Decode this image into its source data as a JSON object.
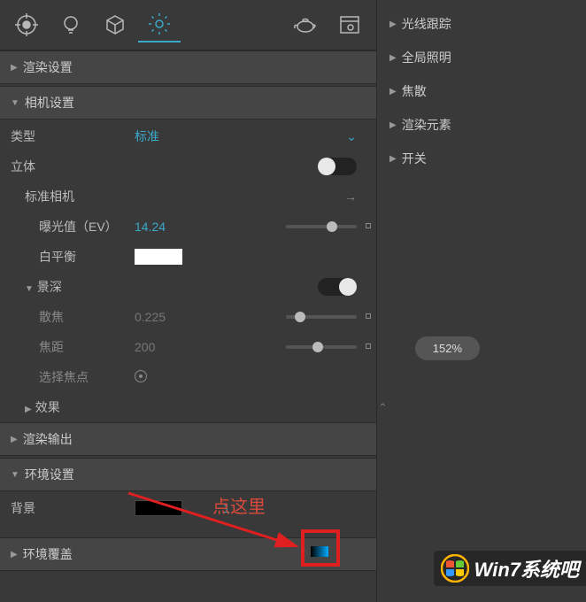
{
  "toolbar": {
    "icons": [
      "target",
      "bulb",
      "cube",
      "gear",
      "teapot",
      "window"
    ]
  },
  "sections": {
    "render_settings": "渲染设置",
    "camera_settings": "相机设置",
    "render_output": "渲染输出",
    "env_settings": "环境设置",
    "env_desc": "环境覆盖"
  },
  "camera": {
    "type_label": "类型",
    "type_value": "标准",
    "stereo_label": "立体",
    "std_camera_label": "标准相机",
    "ev_label": "曝光值（EV）",
    "ev_value": "14.24",
    "wb_label": "白平衡",
    "dof_label": "景深",
    "defocus_label": "散焦",
    "defocus_value": "0.225",
    "focal_label": "焦距",
    "focal_value": "200",
    "pick_focus_label": "选择焦点",
    "effects_label": "效果"
  },
  "env": {
    "bg_label": "背景",
    "bg_value": "1"
  },
  "right_menu": {
    "items": [
      "光线跟踪",
      "全局照明",
      "焦散",
      "渲染元素",
      "开关"
    ]
  },
  "zoom": "152%",
  "annotation": "点这里",
  "watermark": "Win7系统吧"
}
